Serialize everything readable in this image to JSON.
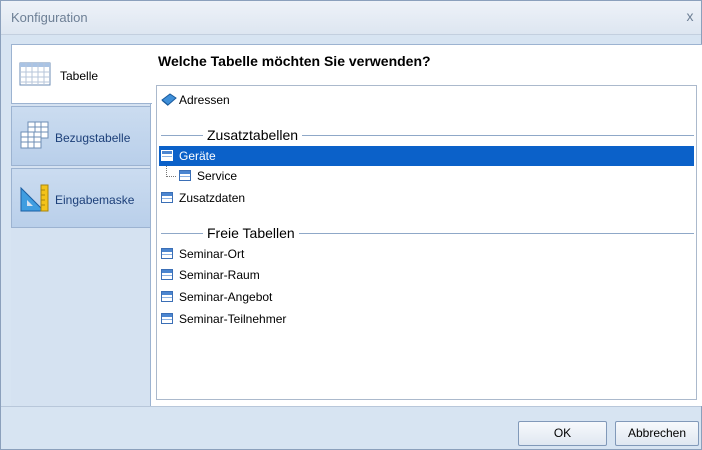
{
  "window": {
    "title": "Konfiguration",
    "close_glyph": "x"
  },
  "sidebar": {
    "tabs": [
      {
        "label": "Tabelle",
        "icon": "table-icon",
        "active": true
      },
      {
        "label": "Bezugstabelle",
        "icon": "related-table-icon",
        "active": false
      },
      {
        "label": "Eingabemaske",
        "icon": "input-mask-icon",
        "active": false
      }
    ]
  },
  "main": {
    "heading": "Welche Tabelle möchten Sie verwenden?",
    "primary_item": {
      "label": "Adressen",
      "icon": "book-icon"
    },
    "groups": [
      {
        "title": "Zusatztabellen",
        "items": [
          {
            "label": "Geräte",
            "selected": true
          },
          {
            "label": "Service",
            "child": true
          },
          {
            "label": "Zusatzdaten"
          }
        ]
      },
      {
        "title": "Freie Tabellen",
        "items": [
          {
            "label": "Seminar-Ort"
          },
          {
            "label": "Seminar-Raum"
          },
          {
            "label": "Seminar-Angebot"
          },
          {
            "label": "Seminar-Teilnehmer"
          }
        ]
      }
    ]
  },
  "footer": {
    "ok_label": "OK",
    "cancel_label": "Abbrechen"
  },
  "colors": {
    "selection": "#0b61c9",
    "frame": "#d7e4f2",
    "accent_text": "#1c3f79"
  }
}
